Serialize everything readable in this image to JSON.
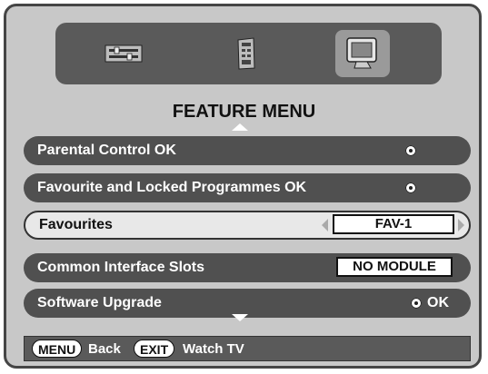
{
  "menu": {
    "title": "FEATURE MENU",
    "tabs": [
      {
        "icon": "settings-sliders-icon",
        "selected": false
      },
      {
        "icon": "remote-control-icon",
        "selected": false
      },
      {
        "icon": "tv-screen-icon",
        "selected": true
      }
    ],
    "items": [
      {
        "label": "Parental Control OK",
        "control": "dot"
      },
      {
        "label": "Favourite and Locked Programmes OK",
        "control": "dot"
      },
      {
        "label": "Favourites",
        "control": "selector",
        "value": "FAV-1",
        "selected": true
      },
      {
        "label": "Common Interface Slots",
        "control": "value",
        "value": "NO MODULE"
      },
      {
        "label": "Software Upgrade",
        "control": "dot-ok",
        "value": "OK"
      }
    ]
  },
  "footer": {
    "menu_key": "MENU",
    "back_label": "Back",
    "exit_key": "EXIT",
    "watch_label": "Watch TV"
  },
  "colors": {
    "panel": "#c8c8c8",
    "row": "#505050",
    "selected_row": "#e8e8e8",
    "tabbar": "#5a5a5a"
  }
}
